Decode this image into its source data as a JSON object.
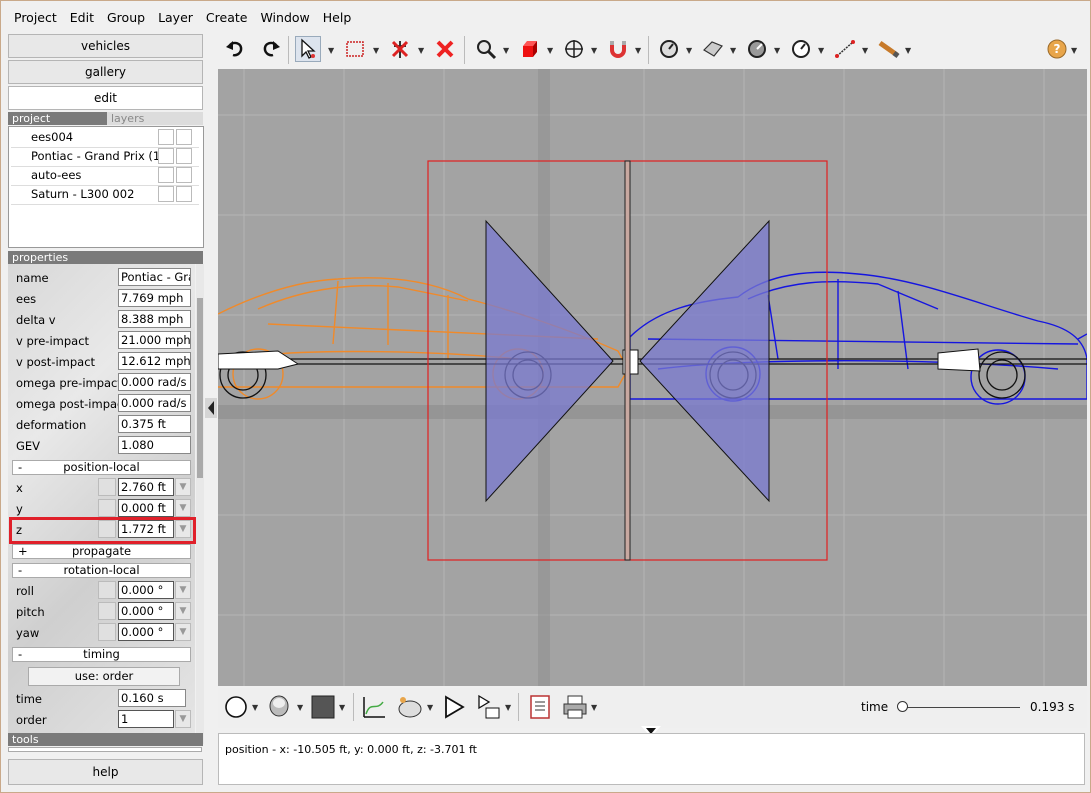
{
  "menu": [
    "Project",
    "Edit",
    "Group",
    "Layer",
    "Create",
    "Window",
    "Help"
  ],
  "nav": {
    "vehicles": "vehicles",
    "gallery": "gallery",
    "edit": "edit",
    "help": "help"
  },
  "project": {
    "tab_project": "project",
    "tab_layers": "layers",
    "items": [
      "ees004",
      "Pontiac - Grand Prix (1...",
      "auto-ees",
      "Saturn - L300 002"
    ]
  },
  "properties": {
    "header": "properties",
    "rows": [
      {
        "key": "name",
        "value": "Pontiac - Grand Prix"
      },
      {
        "key": "ees",
        "value": "7.769 mph"
      },
      {
        "key": "delta v",
        "value": "8.388 mph"
      },
      {
        "key": "v pre-impact",
        "value": "21.000 mph"
      },
      {
        "key": "v post-impact",
        "value": "12.612 mph"
      },
      {
        "key": "omega pre-impact",
        "value": "0.000 rad/s"
      },
      {
        "key": "omega post-impact",
        "value": "0.000 rad/s"
      },
      {
        "key": "deformation",
        "value": "0.375 ft"
      },
      {
        "key": "GEV",
        "value": "1.080"
      }
    ],
    "position_local": {
      "label": "position-local",
      "sign": "-",
      "x": "2.760 ft",
      "y": "0.000 ft",
      "z": "1.772 ft"
    },
    "propagate": {
      "label": "propagate",
      "sign": "+"
    },
    "rotation_local": {
      "label": "rotation-local",
      "sign": "-",
      "roll": "0.000 °",
      "pitch": "0.000 °",
      "yaw": "0.000 °"
    },
    "timing": {
      "label": "timing",
      "sign": "-",
      "use_button": "use: order",
      "time": "0.160 s",
      "order": "1"
    },
    "labels": {
      "x": "x",
      "y": "y",
      "z": "z",
      "roll": "roll",
      "pitch": "pitch",
      "yaw": "yaw",
      "time": "time",
      "order": "order"
    }
  },
  "tools_header": "tools",
  "bottom": {
    "time_label": "time",
    "time_value": "0.193 s",
    "time_fraction": 0.0
  },
  "status": "position - x: -10.505 ft, y: 0.000 ft, z: -3.701 ft",
  "colors": {
    "orange_car": "#f08a2a",
    "blue_car": "#1515e0",
    "red_box": "#e02020",
    "triangle_fill": "#7a7ad0"
  },
  "icons": [
    "undo-icon",
    "redo-icon",
    "select-arrow-icon",
    "select-rect-icon",
    "no-edit-icon",
    "delete-icon",
    "zoom-icon",
    "cube-icon",
    "move-icon",
    "magnet-icon",
    "gauge-icon",
    "surface-icon",
    "measure-icon",
    "speedometer-icon",
    "ruler-icon",
    "wand-icon",
    "help-icon"
  ]
}
